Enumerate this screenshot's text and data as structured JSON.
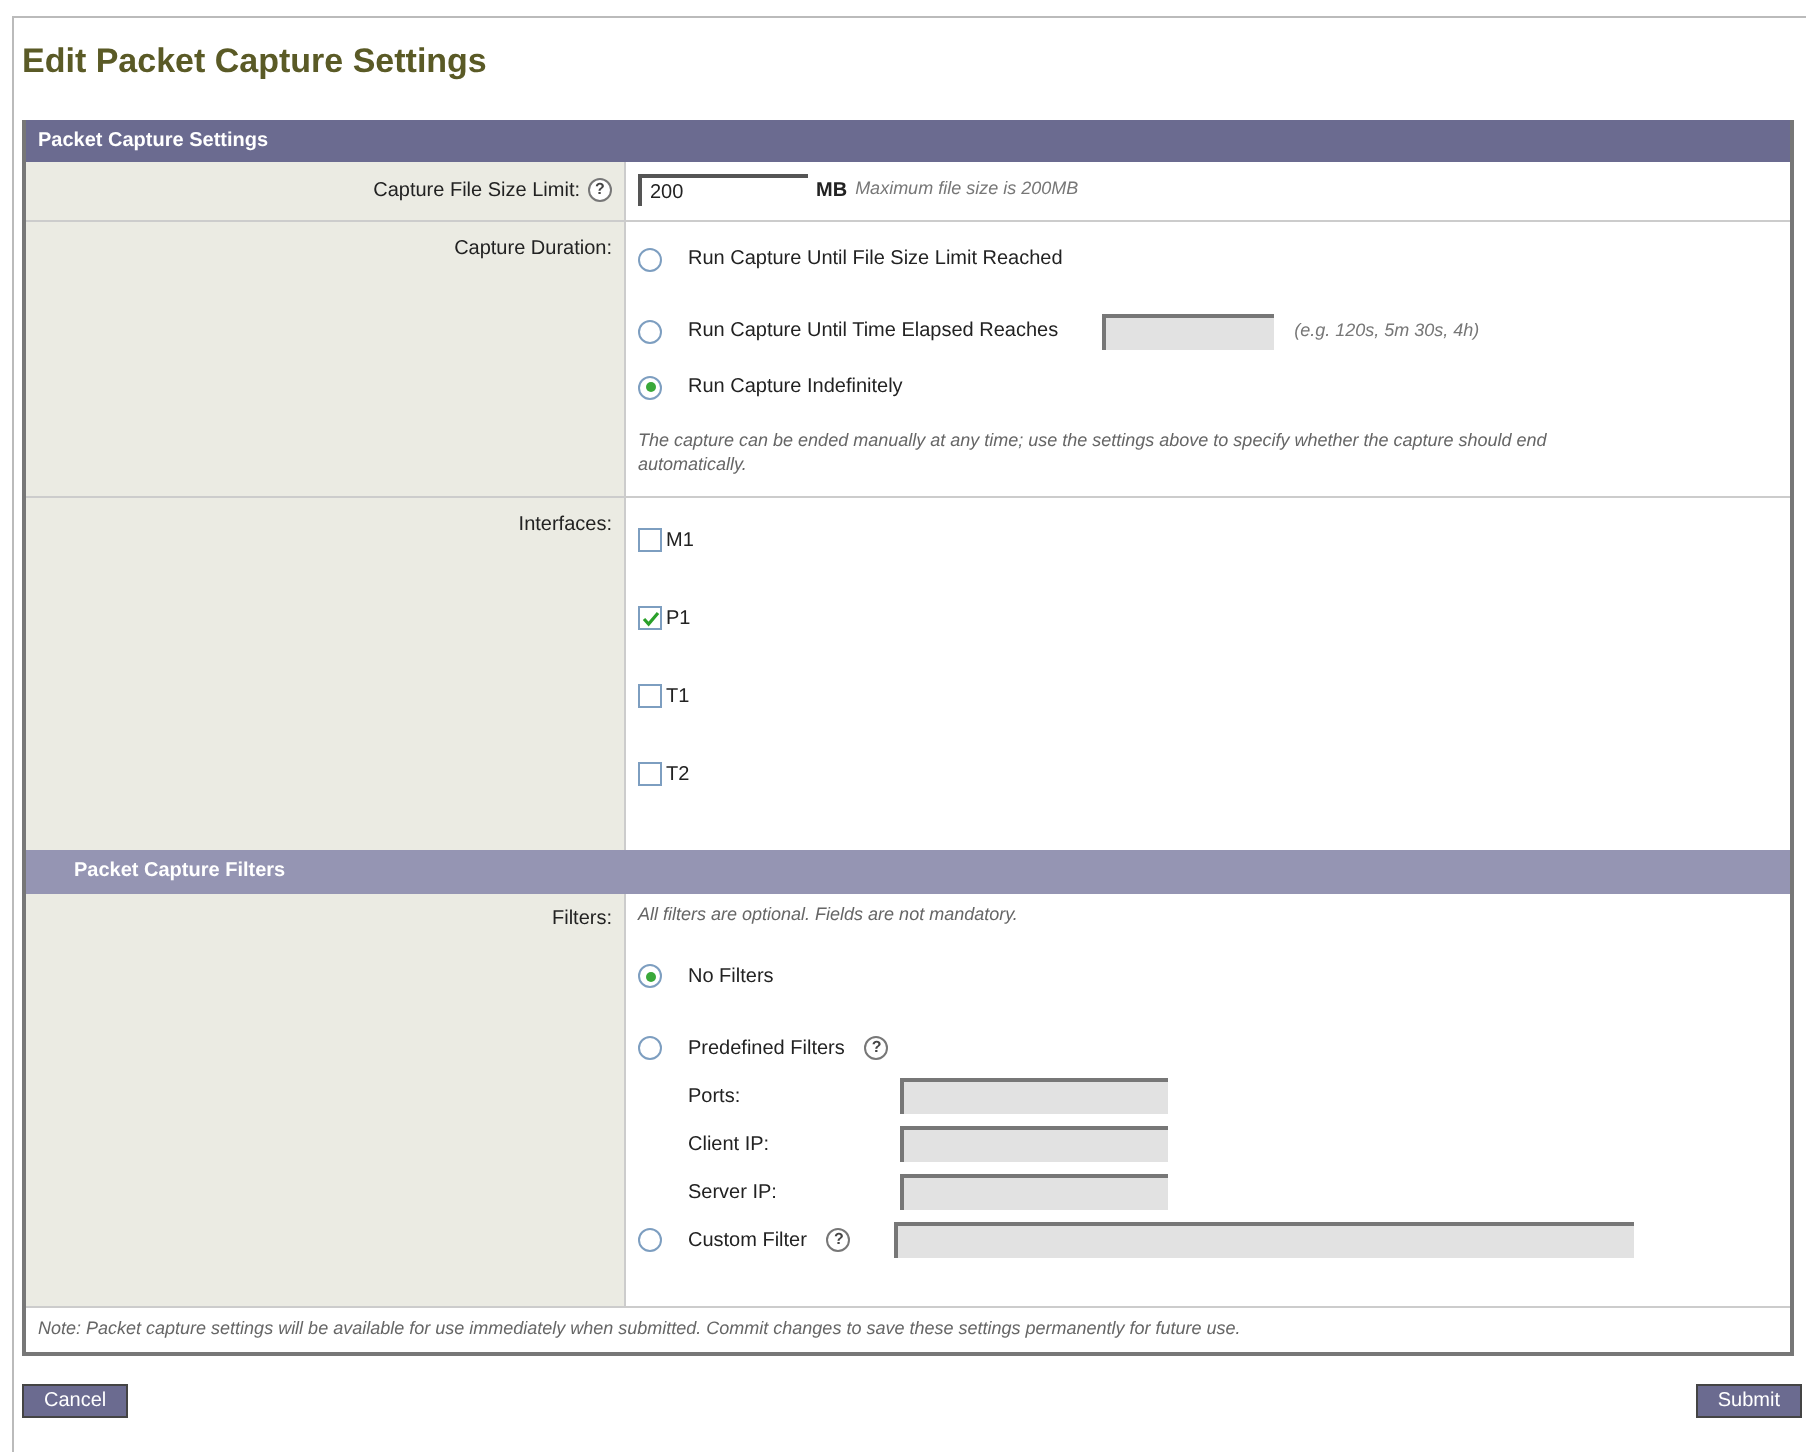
{
  "title": "Edit Packet Capture Settings",
  "settings": {
    "header": "Packet Capture Settings",
    "file_size": {
      "label": "Capture File Size Limit:",
      "help": "?",
      "value": "200",
      "unit": "MB",
      "hint": "Maximum file size is 200MB"
    },
    "duration": {
      "label": "Capture Duration:",
      "options": [
        {
          "label": "Run Capture Until File Size Limit Reached",
          "selected": false,
          "kind": "plain"
        },
        {
          "label": "Run Capture Until Time Elapsed Reaches",
          "selected": false,
          "kind": "field",
          "hint": "(e.g. 120s, 5m 30s, 4h)"
        },
        {
          "label": "Run Capture Indefinitely",
          "selected": true,
          "kind": "plain"
        }
      ],
      "note": "The capture can be ended manually at any time; use the settings above to specify whether the capture should end automatically."
    },
    "interfaces": {
      "label": "Interfaces:",
      "items": [
        {
          "label": "M1",
          "checked": false
        },
        {
          "label": "P1",
          "checked": true
        },
        {
          "label": "T1",
          "checked": false
        },
        {
          "label": "T2",
          "checked": false
        }
      ]
    }
  },
  "filters": {
    "header": "Packet Capture Filters",
    "label": "Filters:",
    "intro": "All filters are optional. Fields are not mandatory.",
    "options": [
      {
        "label": "No Filters",
        "selected": true,
        "kind": "plain"
      },
      {
        "label": "Predefined Filters",
        "selected": false,
        "kind": "subfields",
        "help": "?",
        "fields": [
          {
            "label": "Ports:"
          },
          {
            "label": "Client IP:"
          },
          {
            "label": "Server IP:"
          }
        ]
      },
      {
        "label": "Custom Filter",
        "selected": false,
        "kind": "field",
        "help": "?"
      }
    ]
  },
  "note": "Note: Packet capture settings will be available for use immediately when submitted. Commit changes to save these settings permanently for future use.",
  "buttons": [
    {
      "label": "Cancel"
    },
    {
      "label": "Submit"
    }
  ]
}
